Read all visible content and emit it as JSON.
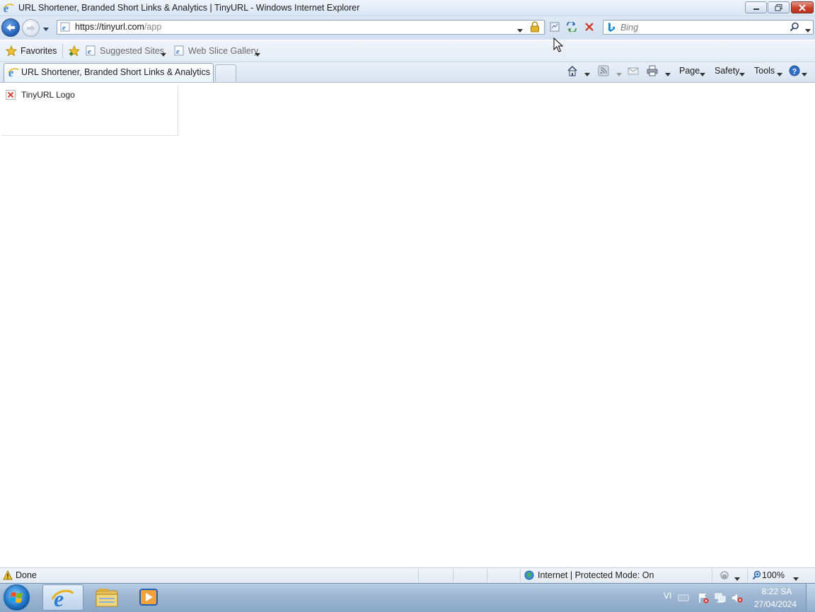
{
  "window": {
    "title": "URL Shortener, Branded Short Links & Analytics | TinyURL - Windows Internet Explorer"
  },
  "address_bar": {
    "url_host": "https://tinyurl.com",
    "url_path": "/app"
  },
  "search": {
    "placeholder": "Bing"
  },
  "favorites_bar": {
    "favorites_label": "Favorites",
    "items": [
      {
        "label": "Suggested Sites"
      },
      {
        "label": "Web Slice Gallery"
      }
    ]
  },
  "tabs": {
    "active_label": "URL Shortener, Branded Short Links & Analytics | ..."
  },
  "command_bar": {
    "page_label": "Page",
    "safety_label": "Safety",
    "tools_label": "Tools"
  },
  "content": {
    "logo_alt_text": "TinyURL Logo"
  },
  "status_bar": {
    "status_text": "Done",
    "zone_text": "Internet | Protected Mode: On",
    "zoom_text": "100%"
  },
  "taskbar": {
    "language": "VI",
    "clock_time": "8:22 SA",
    "clock_date": "27/04/2024"
  },
  "icons": {
    "ie": "ie-logo-icon",
    "back": "back-arrow-icon",
    "forward": "forward-arrow-icon",
    "lock": "lock-icon",
    "refresh": "refresh-icon",
    "stop": "stop-icon",
    "search": "search-magnifier-icon",
    "favorites": "favorites-star-icon",
    "home": "home-icon",
    "feeds": "rss-feed-icon",
    "mail": "read-mail-icon",
    "print": "printer-icon",
    "help": "help-icon",
    "broken_image": "broken-image-icon"
  },
  "colors": {
    "chrome_blue": "#dbe6f4",
    "close_red": "#c7402b",
    "back_button_blue": "#1f5fb8",
    "taskbar": "#9fb7d2"
  }
}
